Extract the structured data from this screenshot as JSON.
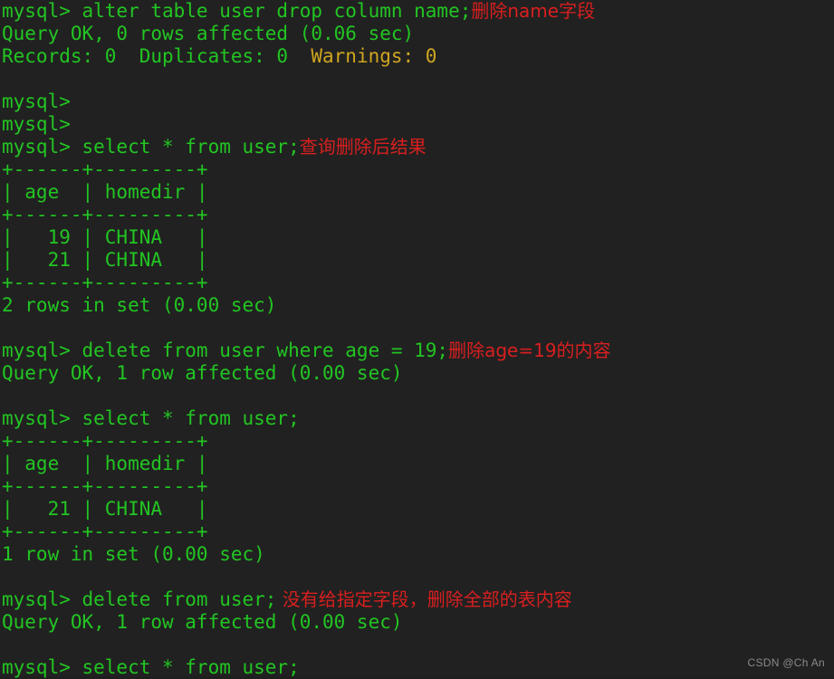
{
  "terminal": {
    "colors": {
      "background": "#212121",
      "green": "#22c522",
      "yellow": "#cfa520",
      "red": "#d81f1f",
      "watermark": "#8a8a8a"
    },
    "prompt": "mysql> ",
    "watermark": "CSDN @Ch An",
    "lines": [
      {
        "id": "l01",
        "green": "mysql> alter table user drop column name;",
        "red": "删除name字段"
      },
      {
        "id": "l02",
        "green": "Query OK, 0 rows affected (0.06 sec)"
      },
      {
        "id": "l03",
        "green": "Records: 0  Duplicates: 0  ",
        "yellow": "Warnings: 0"
      },
      {
        "id": "l04",
        "blank": true
      },
      {
        "id": "l05",
        "green": "mysql>"
      },
      {
        "id": "l06",
        "green": "mysql>"
      },
      {
        "id": "l07",
        "green": "mysql> select * from user;",
        "red": "查询删除后结果"
      },
      {
        "id": "l08",
        "green": "+------+---------+"
      },
      {
        "id": "l09",
        "green": "| age  | homedir |"
      },
      {
        "id": "l10",
        "green": "+------+---------+"
      },
      {
        "id": "l11",
        "green": "|   19 | CHINA   |"
      },
      {
        "id": "l12",
        "green": "|   21 | CHINA   |"
      },
      {
        "id": "l13",
        "green": "+------+---------+"
      },
      {
        "id": "l14",
        "green": "2 rows in set (0.00 sec)"
      },
      {
        "id": "l15",
        "blank": true
      },
      {
        "id": "l16",
        "green": "mysql> delete from user where age = 19;",
        "red": "删除age=19的内容"
      },
      {
        "id": "l17",
        "green": "Query OK, 1 row affected (0.00 sec)"
      },
      {
        "id": "l18",
        "blank": true
      },
      {
        "id": "l19",
        "green": "mysql> select * from user;"
      },
      {
        "id": "l20",
        "green": "+------+---------+"
      },
      {
        "id": "l21",
        "green": "| age  | homedir |"
      },
      {
        "id": "l22",
        "green": "+------+---------+"
      },
      {
        "id": "l23",
        "green": "|   21 | CHINA   |"
      },
      {
        "id": "l24",
        "green": "+------+---------+"
      },
      {
        "id": "l25",
        "green": "1 row in set (0.00 sec)"
      },
      {
        "id": "l26",
        "blank": true
      },
      {
        "id": "l27",
        "green": "mysql> delete from user;",
        "red": " 没有给指定字段，删除全部的表内容"
      },
      {
        "id": "l28",
        "green": "Query OK, 1 row affected (0.00 sec)"
      },
      {
        "id": "l29",
        "blank": true
      },
      {
        "id": "l30",
        "green": "mysql> select * from user;"
      }
    ]
  }
}
